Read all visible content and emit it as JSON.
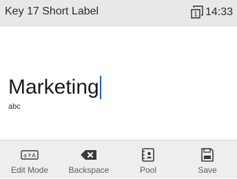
{
  "header": {
    "title": "Key 17 Short Label",
    "line_icon": "line-1-icon",
    "line_icon_text": "1",
    "time": "14:33"
  },
  "entry": {
    "value": "Marketing",
    "input_mode": "abc"
  },
  "softkeys": [
    {
      "label": "Edit Mode",
      "icon": "edit-mode-icon"
    },
    {
      "label": "Backspace",
      "icon": "backspace-icon"
    },
    {
      "label": "Pool",
      "icon": "pool-icon"
    },
    {
      "label": "Save",
      "icon": "save-icon"
    }
  ],
  "colors": {
    "header_bg": "#e8e8e8",
    "softkey_bg": "#eeeeee",
    "caret": "#1f5fbf"
  }
}
